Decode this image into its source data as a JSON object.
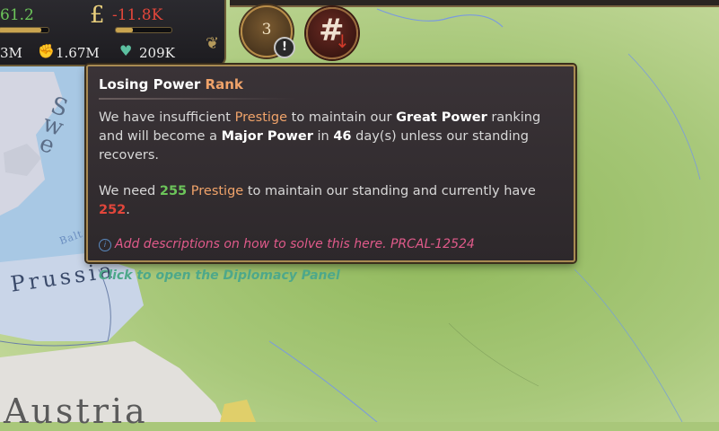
{
  "topbar": {
    "left_value": "61.2",
    "left_bar_fraction": 0.85,
    "money_icon": "£",
    "money_value": "-11.8K",
    "money_bar_fraction": 0.3,
    "pop_a_value": "3M",
    "pop_b_icon": "fist-icon",
    "pop_b_glyph": "✊",
    "pop_b_value": "1.67M",
    "pop_c_icon": "heart-icon",
    "pop_c_glyph": "♥",
    "pop_c_value": "209K"
  },
  "rank": {
    "number": "3",
    "warning_glyph": "!"
  },
  "hash_button": {
    "glyph": "#",
    "arrow": "↓"
  },
  "map": {
    "labels": {
      "prussia": "Prussia",
      "austria": "Austria",
      "sweden": "S\nw\ne",
      "baltic": "Balt"
    }
  },
  "tooltip": {
    "title_part1": "Losing Power",
    "title_part2": "Rank",
    "p1": {
      "t1": "We have insufficient",
      "t2": "Prestige",
      "t3": "to maintain our",
      "t4": "Great Power",
      "t5": "ranking and will become a",
      "t6": "Major Power",
      "t7": "in",
      "t8": "46",
      "t9": "day(s) unless our standing recovers."
    },
    "p2": {
      "t1": "We need",
      "t2": "255",
      "t3": "Prestige",
      "t4": "to maintain our standing and currently have",
      "t5": "252",
      "t6": "."
    },
    "dev_icon": "i",
    "dev_note": "Add descriptions on how to solve this here. PRCAL-12524",
    "action": "Click to open the Diplomacy Panel"
  },
  "colors": {
    "accent_gold": "#f0a36a",
    "positive_green": "#6cc55a",
    "negative_red": "#e2463b",
    "action_teal": "#4ea88a",
    "dev_pink": "#e05a8a"
  }
}
